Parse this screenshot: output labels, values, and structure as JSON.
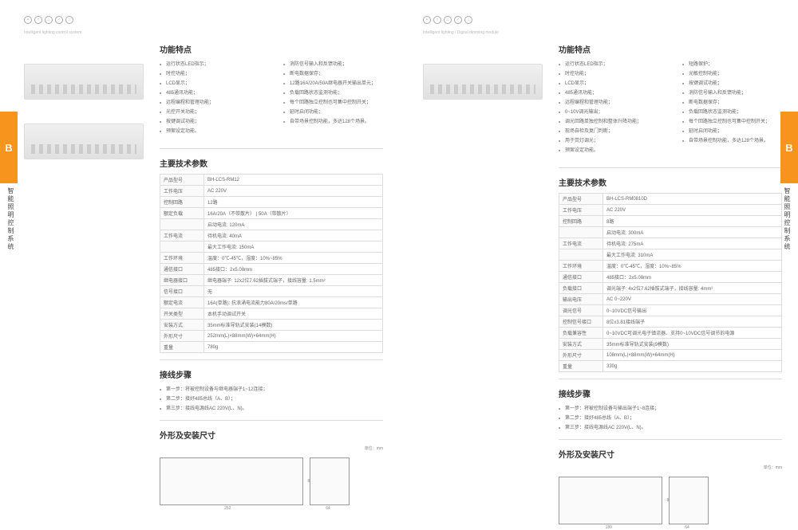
{
  "sideTab": "B",
  "sideLabel": "智能照明控制系统",
  "page1": {
    "subtitle": "Intelligent lighting control system",
    "featuresTitle": "功能特点",
    "featuresCol1": [
      "运行状态LED指示；",
      "时控功能；",
      "LCD显示；",
      "485通讯功能；",
      "远程编程和管理功能；",
      "光控开关功能；",
      "按键调试功能；",
      "预案设定功能。"
    ],
    "featuresCol2": [
      "消防信号输入和反馈功能；",
      "断电数据保存；",
      "12路16A/20A/50A继电器开关输出单元；",
      "负载回路状态监测功能；",
      "每个回路独立控制也可集中控制开关；",
      "延时启闭功能；",
      "自带场景控制功能，多达128个场景。"
    ],
    "specsTitle": "主要技术参数",
    "specs": [
      [
        "产品型号",
        "BH-LCS-RM12"
      ],
      [
        "工作电压",
        "AC 220V"
      ],
      [
        "控制回路",
        "12路"
      ],
      [
        "额定负载",
        "16A/20A（不带散片）  |  50A（带散片）"
      ],
      [
        "",
        "启动电流: 120mA"
      ],
      [
        "工作电流",
        "待机电流: 40mA"
      ],
      [
        "",
        "最大工作电流: 150mA"
      ],
      [
        "工作环境",
        "温度：0℃-45℃，湿度：10%~85%"
      ],
      [
        "通信接口",
        "485接口：2x5.08mm"
      ],
      [
        "继电器接口",
        "继电器端子: 12x2位7.62插拔式端子，接线容量: 1.5mm²"
      ],
      [
        "信号接口",
        "无"
      ],
      [
        "额定电流",
        "16A(单路): 抗浪涌电流能力80A/20ms/单路"
      ],
      [
        "开关类型",
        "本机手动调试开关"
      ],
      [
        "安装方式",
        "35mm标准导轨式安装(14模数)"
      ],
      [
        "外形尺寸",
        "252mm(L)×88mm(W)×64mm(H)"
      ],
      [
        "重量",
        "780g"
      ]
    ],
    "wiringTitle": "接线步骤",
    "wiring": [
      "第一步：将被控制设备与继电器端子1~12连接；",
      "第二步：接好485总线（A、B）；",
      "第三步：接线电源线AC 220V(L、N)。"
    ],
    "dimTitle": "外形及安装尺寸",
    "unit": "单位：mm",
    "dimW": "252",
    "dimD": "64",
    "dimH": "88"
  },
  "page2": {
    "subtitle": "Intelligent lighting / Digital dimming module",
    "featuresTitle": "功能特点",
    "featuresCol1": [
      "运行状态LED指示；",
      "时控功能；",
      "LCD显示；",
      "485通讯功能；",
      "远程编程和管理功能；",
      "0~10V调光输出；",
      "调光回路单独控制和整体升降功能；",
      "现场自检及复门判断；",
      "用于荧灯调光；",
      "预案设定功能。"
    ],
    "featuresCol2": [
      "短路保护；",
      "光敏控制功能；",
      "按键调试功能；",
      "消防信号输入和反馈功能；",
      "断电数据保存；",
      "负载回路状态监测功能；",
      "每个回路独立控制也可集中控制开关；",
      "延时启闭功能；",
      "自带场景控制功能，多达128个场景。"
    ],
    "specsTitle": "主要技术参数",
    "specs": [
      [
        "产品型号",
        "BH-LCS-RM0810D"
      ],
      [
        "工作电压",
        "AC 220V"
      ],
      [
        "控制回路",
        "8路"
      ],
      [
        "",
        "启动电流: 300mA"
      ],
      [
        "工作电流",
        "待机电流: 275mA"
      ],
      [
        "",
        "最大工作电流: 310mA"
      ],
      [
        "工作环境",
        "温度：0℃-45℃，湿度：10%~85%"
      ],
      [
        "通信接口",
        "485接口：2x5.08mm"
      ],
      [
        "负载接口",
        "调光端子: 4x2位7.62插拔式端子，接线容量: 4mm²"
      ],
      [
        "输出电压",
        "AC 0~220V"
      ],
      [
        "调光信号",
        "0~10VDC信号输出"
      ],
      [
        "控制信号接口",
        "8位x3.81接线端子"
      ],
      [
        "负载兼容性",
        "0~10VDC可调光电子镇流器、支持0~10VDC信号调节的电源"
      ],
      [
        "安装方式",
        "35mm标准导轨式安装(9模数)"
      ],
      [
        "外形尺寸",
        "108mm(L)×88mm(W)×64mm(H)"
      ],
      [
        "重量",
        "330g"
      ]
    ],
    "wiringTitle": "接线步骤",
    "wiring": [
      "第一步：将被控制设备与输出端子1~8连接；",
      "第二步：接好485总线（A、B）；",
      "第三步：接线电源线AC 220V(L、N)。"
    ],
    "dimTitle": "外形及安装尺寸",
    "unit": "单位：mm",
    "dimW": "180",
    "dimD": "64",
    "dimH": "88"
  }
}
